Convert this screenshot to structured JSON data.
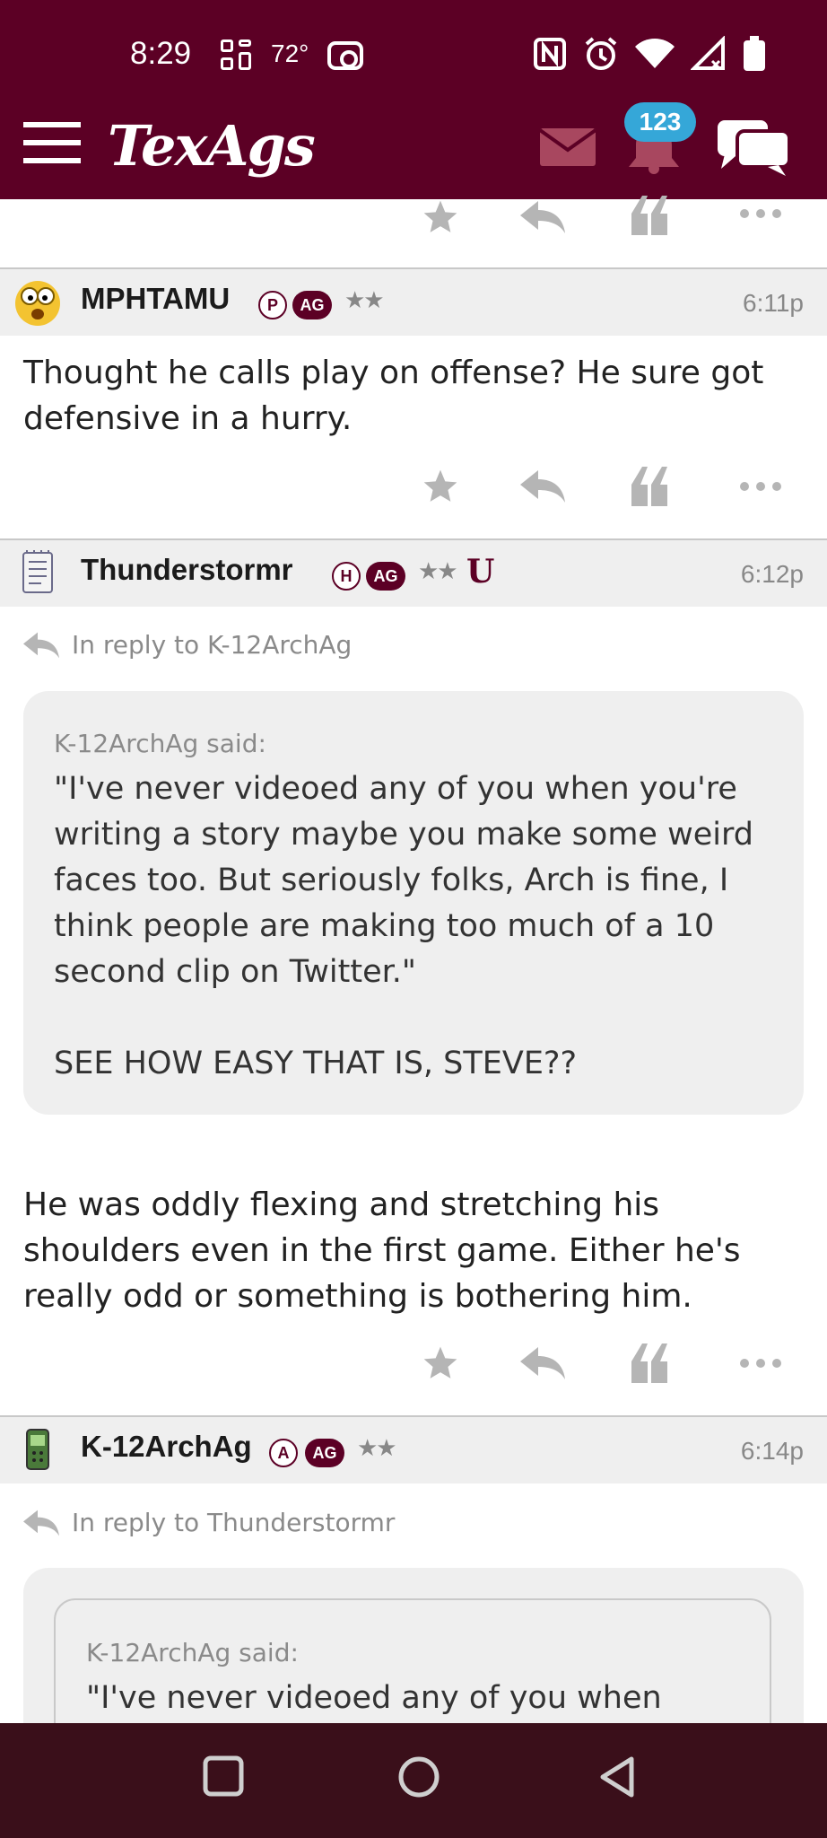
{
  "status_bar": {
    "time": "8:29",
    "temperature": "72°"
  },
  "header": {
    "logo": "TexAgs",
    "notification_count": "123"
  },
  "posts": [
    {
      "username": "MPHTAMU",
      "badge_letter": "P",
      "badge_ag": "AG",
      "stars": "★★",
      "time": "6:11p",
      "body": "Thought he calls play on offense? He sure got defensive in a hurry."
    },
    {
      "username": "Thunderstormr",
      "badge_letter": "H",
      "badge_ag": "AG",
      "stars": "★★",
      "extra_badge": "U",
      "time": "6:12p",
      "reply_to": "In reply to K-12ArchAg",
      "quote_said": "K-12ArchAg said:",
      "quote_text": "\"I've never videoed any of you when you're writing a story maybe you make some weird faces too. But seriously folks, Arch is fine, I think people are making too much of a 10 second clip on Twitter.\"\n\nSEE HOW EASY THAT IS, STEVE??",
      "body": "He was oddly flexing and stretching his shoulders even in the first game. Either he's really odd or something is bothering him."
    },
    {
      "username": "K-12ArchAg",
      "badge_letter": "A",
      "badge_ag": "AG",
      "stars": "★★",
      "time": "6:14p",
      "reply_to": "In reply to Thunderstormr",
      "quote_said": "K-12ArchAg said:",
      "quote_text": "\"I've never videoed any of you when"
    }
  ],
  "icons": {
    "star": "star-icon",
    "reply": "reply-icon",
    "quote": "quote-icon",
    "more": "more-icon"
  },
  "colors": {
    "maroon": "#5c0025",
    "badge_blue": "#35a7d8",
    "nav_dark": "#3a0f1a"
  }
}
